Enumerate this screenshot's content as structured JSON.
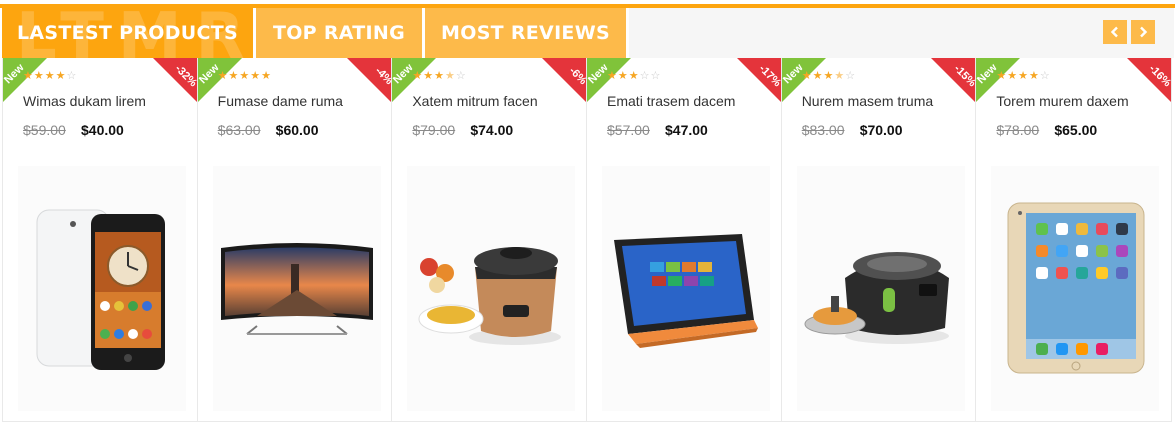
{
  "tabs": [
    {
      "label": "LASTEST PRODUCTS",
      "active": true
    },
    {
      "label": "TOP RATING",
      "active": false
    },
    {
      "label": "MOST REVIEWS",
      "active": false
    }
  ],
  "tab_ghost_text": "LTMR",
  "nav": {
    "prev_icon": "chevron-left-icon",
    "next_icon": "chevron-right-icon"
  },
  "colors": {
    "accent": "#fda50f",
    "tab_inactive": "#fdba4a",
    "new_badge": "#80c33a",
    "sale_badge": "#e4343b",
    "star": "#f6a623"
  },
  "products": [
    {
      "badge_new": "New",
      "discount": "-32%",
      "rating": 4,
      "name": "Wimas dukam lirem",
      "old_price": "$59.00",
      "price": "$40.00",
      "image": "smartphone"
    },
    {
      "badge_new": "New",
      "discount": "-4%",
      "rating": 5,
      "name": "Fumase dame ruma",
      "old_price": "$63.00",
      "price": "$60.00",
      "image": "curved-tv"
    },
    {
      "badge_new": "New",
      "discount": "-6%",
      "rating": 3.5,
      "name": "Xatem mitrum facen",
      "old_price": "$79.00",
      "price": "$74.00",
      "image": "rice-cooker"
    },
    {
      "badge_new": "New",
      "discount": "-17%",
      "rating": 3,
      "name": "Emati trasem dacem",
      "old_price": "$57.00",
      "price": "$47.00",
      "image": "convertible-laptop"
    },
    {
      "badge_new": "New",
      "discount": "-15%",
      "rating": 3.5,
      "name": "Nurem masem truma",
      "old_price": "$83.00",
      "price": "$70.00",
      "image": "air-fryer"
    },
    {
      "badge_new": "New",
      "discount": "-16%",
      "rating": 4,
      "name": "Torem murem daxem",
      "old_price": "$78.00",
      "price": "$65.00",
      "image": "tablet"
    }
  ]
}
